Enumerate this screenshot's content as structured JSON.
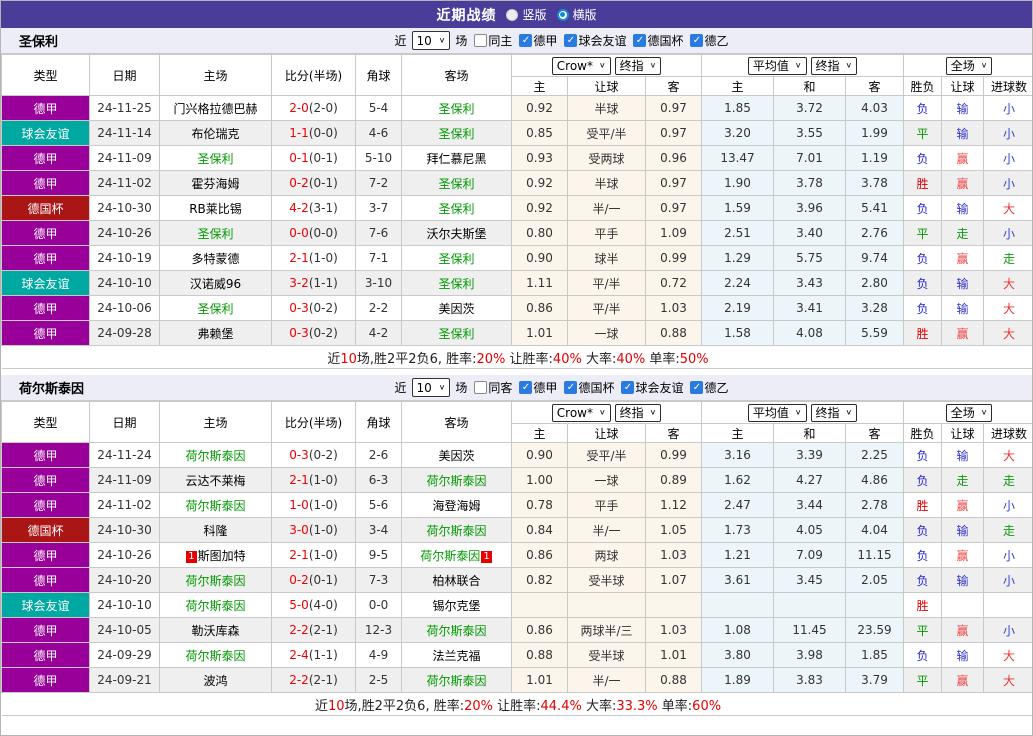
{
  "title_bar": {
    "title": "近期战绩",
    "vertical_label": "竖版",
    "horizontal_label": "横版"
  },
  "icons": {
    "chevron": "∨"
  },
  "league_colors": {
    "德甲": "#990099",
    "球会友谊": "#00a8a2",
    "德国杯": "#aa1616"
  },
  "result_colors": {
    "胜": "#dd0000",
    "平": "#009900",
    "负": "#2323cc",
    "赢": "#ee4444",
    "输": "#3333cc",
    "走": "#119911",
    "大": "#ee3333",
    "小": "#3344cc"
  },
  "sections": [
    {
      "team": "圣保利",
      "filter": {
        "near": "近",
        "count": "10",
        "games": "场",
        "same": "同主",
        "leagues": [
          "德甲",
          "球会友谊",
          "德国杯",
          "德乙"
        ]
      },
      "header": {
        "type": "类型",
        "date": "日期",
        "home": "主场",
        "score": "比分(半场)",
        "corner": "角球",
        "away": "客场",
        "crow_select": "Crow*",
        "final_select": "终指",
        "avg_select": "平均值",
        "final_select2": "终指",
        "full_select": "全场",
        "crow_cols": [
          "主",
          "让球",
          "客"
        ],
        "avg_cols": [
          "主",
          "和",
          "客"
        ],
        "result_cols": [
          "胜负",
          "让球",
          "进球数"
        ]
      },
      "rows": [
        {
          "league": "德甲",
          "date": "24-11-25",
          "home": "门兴格拉德巴赫",
          "home_focus": false,
          "score": "2-0",
          "half": "(2-0)",
          "corner": "5-4",
          "away": "圣保利",
          "away_focus": true,
          "crow": [
            "0.92",
            "半球",
            "0.97"
          ],
          "avg": [
            "1.85",
            "3.72",
            "4.03"
          ],
          "result": [
            "负",
            "输",
            "小"
          ]
        },
        {
          "league": "球会友谊",
          "date": "24-11-14",
          "home": "布伦瑞克",
          "home_focus": false,
          "score": "1-1",
          "half": "(0-0)",
          "corner": "4-6",
          "away": "圣保利",
          "away_focus": true,
          "crow": [
            "0.85",
            "受平/半",
            "0.97"
          ],
          "avg": [
            "3.20",
            "3.55",
            "1.99"
          ],
          "result": [
            "平",
            "输",
            "小"
          ]
        },
        {
          "league": "德甲",
          "date": "24-11-09",
          "home": "圣保利",
          "home_focus": true,
          "score": "0-1",
          "half": "(0-1)",
          "corner": "5-10",
          "away": "拜仁慕尼黑",
          "away_focus": false,
          "crow": [
            "0.93",
            "受两球",
            "0.96"
          ],
          "avg": [
            "13.47",
            "7.01",
            "1.19"
          ],
          "result": [
            "负",
            "赢",
            "小"
          ]
        },
        {
          "league": "德甲",
          "date": "24-11-02",
          "home": "霍芬海姆",
          "home_focus": false,
          "score": "0-2",
          "half": "(0-1)",
          "corner": "7-2",
          "away": "圣保利",
          "away_focus": true,
          "crow": [
            "0.92",
            "半球",
            "0.97"
          ],
          "avg": [
            "1.90",
            "3.78",
            "3.78"
          ],
          "result": [
            "胜",
            "赢",
            "小"
          ]
        },
        {
          "league": "德国杯",
          "date": "24-10-30",
          "home": "RB莱比锡",
          "home_focus": false,
          "score": "4-2",
          "half": "(3-1)",
          "corner": "3-7",
          "away": "圣保利",
          "away_focus": true,
          "crow": [
            "0.92",
            "半/一",
            "0.97"
          ],
          "avg": [
            "1.59",
            "3.96",
            "5.41"
          ],
          "result": [
            "负",
            "输",
            "大"
          ]
        },
        {
          "league": "德甲",
          "date": "24-10-26",
          "home": "圣保利",
          "home_focus": true,
          "score": "0-0",
          "half": "(0-0)",
          "corner": "7-6",
          "away": "沃尔夫斯堡",
          "away_focus": false,
          "crow": [
            "0.80",
            "平手",
            "1.09"
          ],
          "avg": [
            "2.51",
            "3.40",
            "2.76"
          ],
          "result": [
            "平",
            "走",
            "小"
          ]
        },
        {
          "league": "德甲",
          "date": "24-10-19",
          "home": "多特蒙德",
          "home_focus": false,
          "score": "2-1",
          "half": "(1-0)",
          "corner": "7-1",
          "away": "圣保利",
          "away_focus": true,
          "crow": [
            "0.90",
            "球半",
            "0.99"
          ],
          "avg": [
            "1.29",
            "5.75",
            "9.74"
          ],
          "result": [
            "负",
            "赢",
            "走"
          ]
        },
        {
          "league": "球会友谊",
          "date": "24-10-10",
          "home": "汉诺威96",
          "home_focus": false,
          "score": "3-2",
          "half": "(1-1)",
          "corner": "3-10",
          "away": "圣保利",
          "away_focus": true,
          "crow": [
            "1.11",
            "平/半",
            "0.72"
          ],
          "avg": [
            "2.24",
            "3.43",
            "2.80"
          ],
          "result": [
            "负",
            "输",
            "大"
          ]
        },
        {
          "league": "德甲",
          "date": "24-10-06",
          "home": "圣保利",
          "home_focus": true,
          "score": "0-3",
          "half": "(0-2)",
          "corner": "2-2",
          "away": "美因茨",
          "away_focus": false,
          "crow": [
            "0.86",
            "平/半",
            "1.03"
          ],
          "avg": [
            "2.19",
            "3.41",
            "3.28"
          ],
          "result": [
            "负",
            "输",
            "大"
          ]
        },
        {
          "league": "德甲",
          "date": "24-09-28",
          "home": "弗赖堡",
          "home_focus": false,
          "score": "0-3",
          "half": "(0-2)",
          "corner": "4-2",
          "away": "圣保利",
          "away_focus": true,
          "crow": [
            "1.01",
            "一球",
            "0.88"
          ],
          "avg": [
            "1.58",
            "4.08",
            "5.59"
          ],
          "result": [
            "胜",
            "赢",
            "大"
          ]
        }
      ],
      "summary": [
        {
          "t": "近"
        },
        {
          "t": "10",
          "red": true
        },
        {
          "t": "场,胜2平2负6, 胜率:"
        },
        {
          "t": "20%",
          "red": true
        },
        {
          "t": " 让胜率:"
        },
        {
          "t": "40%",
          "red": true
        },
        {
          "t": " 大率:"
        },
        {
          "t": "40%",
          "red": true
        },
        {
          "t": " 单率:"
        },
        {
          "t": "50%",
          "red": true
        }
      ]
    },
    {
      "team": "荷尔斯泰因",
      "filter": {
        "near": "近",
        "count": "10",
        "games": "场",
        "same": "同客",
        "leagues": [
          "德甲",
          "德国杯",
          "球会友谊",
          "德乙"
        ]
      },
      "header": {
        "type": "类型",
        "date": "日期",
        "home": "主场",
        "score": "比分(半场)",
        "corner": "角球",
        "away": "客场",
        "crow_select": "Crow*",
        "final_select": "终指",
        "avg_select": "平均值",
        "final_select2": "终指",
        "full_select": "全场",
        "crow_cols": [
          "主",
          "让球",
          "客"
        ],
        "avg_cols": [
          "主",
          "和",
          "客"
        ],
        "result_cols": [
          "胜负",
          "让球",
          "进球数"
        ]
      },
      "rows": [
        {
          "league": "德甲",
          "date": "24-11-24",
          "home": "荷尔斯泰因",
          "home_focus": true,
          "score": "0-3",
          "half": "(0-2)",
          "corner": "2-6",
          "away": "美因茨",
          "away_focus": false,
          "crow": [
            "0.90",
            "受平/半",
            "0.99"
          ],
          "avg": [
            "3.16",
            "3.39",
            "2.25"
          ],
          "result": [
            "负",
            "输",
            "大"
          ]
        },
        {
          "league": "德甲",
          "date": "24-11-09",
          "home": "云达不莱梅",
          "home_focus": false,
          "score": "2-1",
          "half": "(1-0)",
          "corner": "6-3",
          "away": "荷尔斯泰因",
          "away_focus": true,
          "crow": [
            "1.00",
            "一球",
            "0.89"
          ],
          "avg": [
            "1.62",
            "4.27",
            "4.86"
          ],
          "result": [
            "负",
            "走",
            "走"
          ]
        },
        {
          "league": "德甲",
          "date": "24-11-02",
          "home": "荷尔斯泰因",
          "home_focus": true,
          "score": "1-0",
          "half": "(1-0)",
          "corner": "5-6",
          "away": "海登海姆",
          "away_focus": false,
          "crow": [
            "0.78",
            "平手",
            "1.12"
          ],
          "avg": [
            "2.47",
            "3.44",
            "2.78"
          ],
          "result": [
            "胜",
            "赢",
            "小"
          ]
        },
        {
          "league": "德国杯",
          "date": "24-10-30",
          "home": "科隆",
          "home_focus": false,
          "score": "3-0",
          "half": "(1-0)",
          "corner": "3-4",
          "away": "荷尔斯泰因",
          "away_focus": true,
          "crow": [
            "0.84",
            "半/一",
            "1.05"
          ],
          "avg": [
            "1.73",
            "4.05",
            "4.04"
          ],
          "result": [
            "负",
            "输",
            "走"
          ]
        },
        {
          "league": "德甲",
          "date": "24-10-26",
          "home": "斯图加特",
          "home_focus": false,
          "home_badge": "1",
          "score": "2-1",
          "half": "(1-0)",
          "corner": "9-5",
          "away": "荷尔斯泰因",
          "away_focus": true,
          "away_badge": "1",
          "crow": [
            "0.86",
            "两球",
            "1.03"
          ],
          "avg": [
            "1.21",
            "7.09",
            "11.15"
          ],
          "result": [
            "负",
            "赢",
            "小"
          ]
        },
        {
          "league": "德甲",
          "date": "24-10-20",
          "home": "荷尔斯泰因",
          "home_focus": true,
          "score": "0-2",
          "half": "(0-1)",
          "corner": "7-3",
          "away": "柏林联合",
          "away_focus": false,
          "crow": [
            "0.82",
            "受半球",
            "1.07"
          ],
          "avg": [
            "3.61",
            "3.45",
            "2.05"
          ],
          "result": [
            "负",
            "输",
            "小"
          ]
        },
        {
          "league": "球会友谊",
          "date": "24-10-10",
          "home": "荷尔斯泰因",
          "home_focus": true,
          "score": "5-0",
          "half": "(4-0)",
          "corner": "0-0",
          "away": "锡尔克堡",
          "away_focus": false,
          "crow": [
            "",
            "",
            ""
          ],
          "avg": [
            "",
            "",
            ""
          ],
          "result": [
            "胜",
            "",
            ""
          ]
        },
        {
          "league": "德甲",
          "date": "24-10-05",
          "home": "勒沃库森",
          "home_focus": false,
          "score": "2-2",
          "half": "(2-1)",
          "corner": "12-3",
          "away": "荷尔斯泰因",
          "away_focus": true,
          "crow": [
            "0.86",
            "两球半/三",
            "1.03"
          ],
          "avg": [
            "1.08",
            "11.45",
            "23.59"
          ],
          "result": [
            "平",
            "赢",
            "小"
          ]
        },
        {
          "league": "德甲",
          "date": "24-09-29",
          "home": "荷尔斯泰因",
          "home_focus": true,
          "score": "2-4",
          "half": "(1-1)",
          "corner": "4-9",
          "away": "法兰克福",
          "away_focus": false,
          "crow": [
            "0.88",
            "受半球",
            "1.01"
          ],
          "avg": [
            "3.80",
            "3.98",
            "1.85"
          ],
          "result": [
            "负",
            "输",
            "大"
          ]
        },
        {
          "league": "德甲",
          "date": "24-09-21",
          "home": "波鸿",
          "home_focus": false,
          "score": "2-2",
          "half": "(2-1)",
          "corner": "2-5",
          "away": "荷尔斯泰因",
          "away_focus": true,
          "crow": [
            "1.01",
            "半/一",
            "0.88"
          ],
          "avg": [
            "1.89",
            "3.83",
            "3.79"
          ],
          "result": [
            "平",
            "赢",
            "大"
          ]
        }
      ],
      "summary": [
        {
          "t": "近"
        },
        {
          "t": "10",
          "red": true
        },
        {
          "t": "场,胜2平2负6, 胜率:"
        },
        {
          "t": "20%",
          "red": true
        },
        {
          "t": " 让胜率:"
        },
        {
          "t": "44.4%",
          "red": true
        },
        {
          "t": " 大率:"
        },
        {
          "t": "33.3%",
          "red": true
        },
        {
          "t": " 单率:"
        },
        {
          "t": "60%",
          "red": true
        }
      ]
    }
  ]
}
